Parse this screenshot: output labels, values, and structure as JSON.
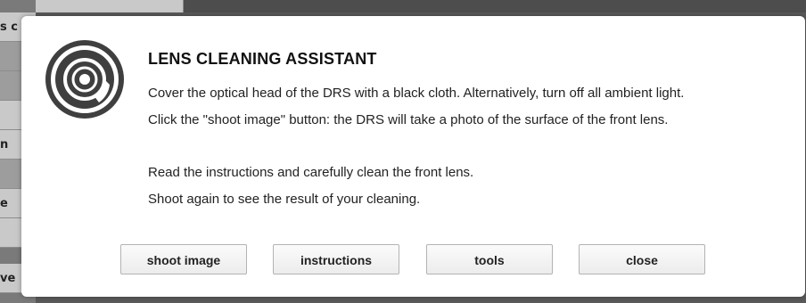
{
  "background": {
    "rows": [
      {
        "text": "s c",
        "shade": "light"
      },
      {
        "text": "",
        "shade": "dark"
      },
      {
        "text": "",
        "shade": "dark"
      },
      {
        "text": "",
        "shade": "light"
      },
      {
        "text": "n",
        "shade": "light"
      },
      {
        "text": "",
        "shade": "dark"
      },
      {
        "text": "e",
        "shade": "light"
      },
      {
        "text": "",
        "shade": "light"
      },
      {
        "text": "ve",
        "shade": "light"
      }
    ]
  },
  "dialog": {
    "icon": "camera-lens-icon",
    "title": "LENS CLEANING ASSISTANT",
    "lines": [
      "Cover the optical head of the DRS with a black cloth. Alternatively, turn off all ambient light.",
      "Click the \"shoot image\" button: the DRS will take a photo of the surface of the front lens.",
      "Read the instructions and carefully clean the front lens.",
      "Shoot again to see the result of your cleaning."
    ],
    "buttons": {
      "shoot": "shoot image",
      "instructions": "instructions",
      "tools": "tools",
      "close": "close"
    }
  },
  "colors": {
    "overlay": "#5a5a5a",
    "dialog_bg": "#ffffff",
    "icon": "#3f3f3f"
  }
}
